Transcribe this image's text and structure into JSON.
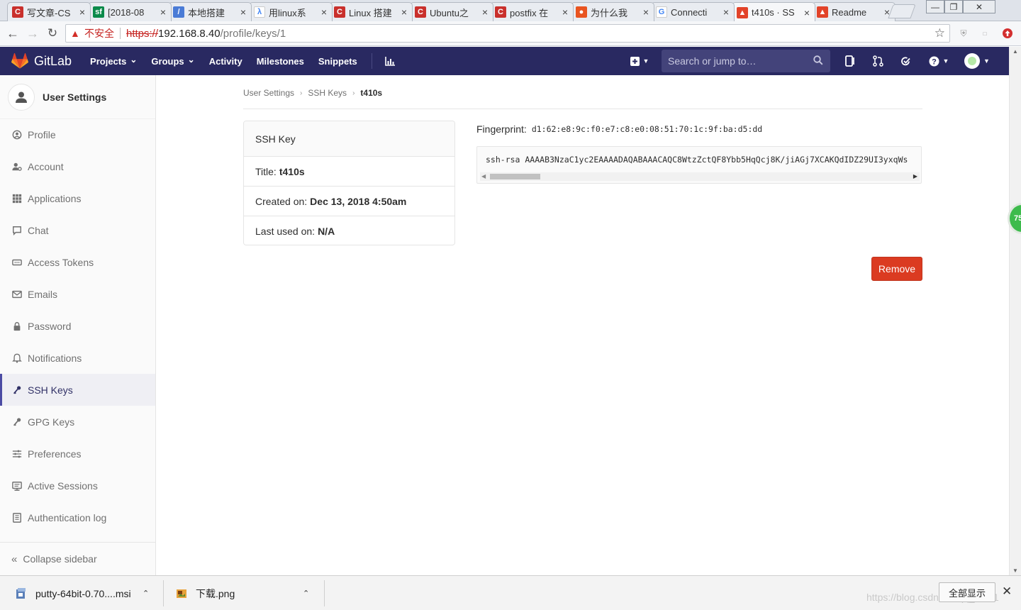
{
  "browser": {
    "tabs": [
      {
        "label": "写文章-CS",
        "fav_color": "#c9302c",
        "fav_glyph": "C"
      },
      {
        "label": "[2018-08",
        "fav_color": "#0b8a4a",
        "fav_glyph": "sf"
      },
      {
        "label": "本地搭建",
        "fav_color": "#4a7bd6",
        "fav_glyph": "/"
      },
      {
        "label": "用linux系",
        "fav_color": "#ffffff",
        "fav_glyph": "λ"
      },
      {
        "label": "Linux 搭建",
        "fav_color": "#c9302c",
        "fav_glyph": "C"
      },
      {
        "label": "Ubuntu之",
        "fav_color": "#c9302c",
        "fav_glyph": "C"
      },
      {
        "label": "postfix 在",
        "fav_color": "#c9302c",
        "fav_glyph": "C"
      },
      {
        "label": "为什么我",
        "fav_color": "#e95420",
        "fav_glyph": "●"
      },
      {
        "label": "Connecti",
        "fav_color": "#ffffff",
        "fav_glyph": "G"
      },
      {
        "label": "t410s · SS",
        "fav_color": "#e24329",
        "fav_glyph": "▲"
      },
      {
        "label": "Readme",
        "fav_color": "#e24329",
        "fav_glyph": "▲"
      }
    ],
    "active_tab_index": 9,
    "address": {
      "insecure_label": "不安全",
      "scheme": "https://",
      "host": "192.168.8.40",
      "path": "/profile/keys/1"
    }
  },
  "gitlab": {
    "brand": "GitLab",
    "menu": [
      {
        "label": "Projects",
        "has_caret": true
      },
      {
        "label": "Groups",
        "has_caret": true
      },
      {
        "label": "Activity",
        "has_caret": false
      },
      {
        "label": "Milestones",
        "has_caret": false
      },
      {
        "label": "Snippets",
        "has_caret": false
      }
    ],
    "search_placeholder": "Search or jump to…"
  },
  "sidebar": {
    "title": "User Settings",
    "items": [
      {
        "label": "Profile",
        "icon": "profile-icon"
      },
      {
        "label": "Account",
        "icon": "account-icon"
      },
      {
        "label": "Applications",
        "icon": "applications-icon"
      },
      {
        "label": "Chat",
        "icon": "chat-icon"
      },
      {
        "label": "Access Tokens",
        "icon": "access-tokens-icon"
      },
      {
        "label": "Emails",
        "icon": "emails-icon"
      },
      {
        "label": "Password",
        "icon": "password-icon"
      },
      {
        "label": "Notifications",
        "icon": "notifications-icon"
      },
      {
        "label": "SSH Keys",
        "icon": "ssh-keys-icon"
      },
      {
        "label": "GPG Keys",
        "icon": "gpg-keys-icon"
      },
      {
        "label": "Preferences",
        "icon": "preferences-icon"
      },
      {
        "label": "Active Sessions",
        "icon": "active-sessions-icon"
      },
      {
        "label": "Authentication log",
        "icon": "authentication-log-icon"
      }
    ],
    "active_index": 8,
    "collapse_label": "Collapse sidebar"
  },
  "breadcrumb": [
    "User Settings",
    "SSH Keys",
    "t410s"
  ],
  "key_card": {
    "header": "SSH Key",
    "title_label": "Title:",
    "title_value": "t410s",
    "created_label": "Created on:",
    "created_value": "Dec 13, 2018 4:50am",
    "last_used_label": "Last used on:",
    "last_used_value": "N/A"
  },
  "fingerprint": {
    "label": "Fingerprint:",
    "value": "d1:62:e8:9c:f0:e7:c8:e0:08:51:70:1c:9f:ba:d5:dd"
  },
  "public_key": "ssh-rsa AAAAB3NzaC1yc2EAAAADAQABAAACAQC8WtzZctQF8Ybb5HqQcj8K/jiAGj7XCAKQdIDZ29UI3yxqWs",
  "remove_label": "Remove",
  "float_badge": "75",
  "downloads": {
    "items": [
      "putty-64bit-0.70....msi",
      "下载.png"
    ],
    "show_all_label": "全部显示",
    "watermark": "https://blog.csdn.net/qq_luo01"
  }
}
